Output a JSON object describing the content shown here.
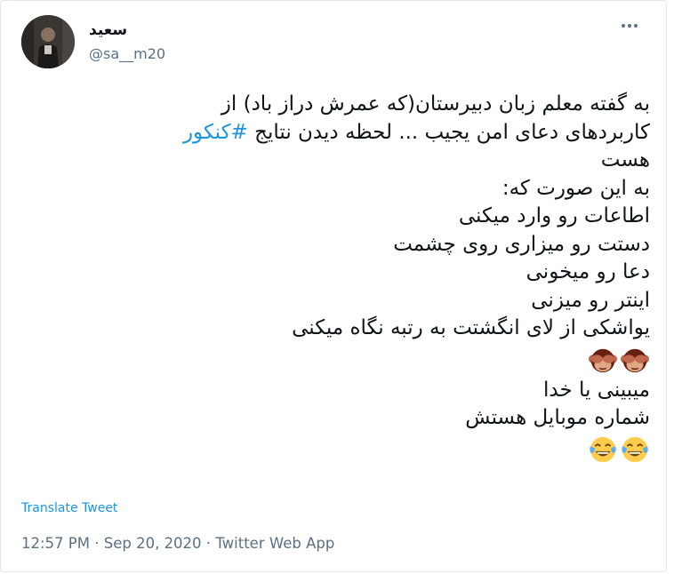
{
  "user": {
    "display_name": "سعید",
    "handle": "@sa__m20",
    "avatar_icon": "profile-photo"
  },
  "tweet": {
    "lines": [
      "به گفته معلم زبان دبیرستان(که عمرش دراز باد) از",
      "کاربردهای دعای امن یجیب ... لحظه دیدن نتایج ",
      "هست",
      "به این صورت که:",
      "اطاعات رو وارد میکنی",
      "دستت رو میزاری روی چشمت",
      "دعا رو میخونی",
      "اینتر رو میزنی",
      "یواشکی از لای انگشتت به رتبه نگاه میکنی",
      "میبینی یا خدا",
      "شماره موبایل هستش"
    ],
    "hashtag": "#کنکور",
    "emoji_row_1": [
      "see-no-evil-monkey",
      "see-no-evil-monkey"
    ],
    "emoji_row_2": [
      "face-with-tears-of-joy",
      "face-with-tears-of-joy"
    ]
  },
  "translate_label": "Translate Tweet",
  "meta": {
    "time": "12:57 PM",
    "separator": " · ",
    "date": "Sep 20, 2020",
    "source": "Twitter Web App"
  },
  "colors": {
    "link": "#1b95e0",
    "secondary": "#5b7083",
    "text": "#0f1419"
  }
}
